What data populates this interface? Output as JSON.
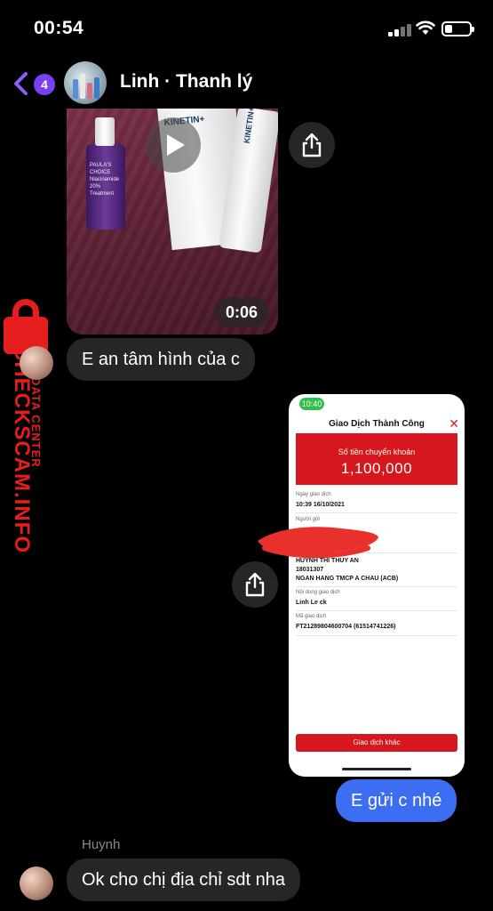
{
  "status_bar": {
    "time": "00:54",
    "signal_bars": 4,
    "battery_level_percent": 30
  },
  "header": {
    "back_count": "4",
    "title": "Linh · Thanh lý",
    "accent_color": "#7b3ff2"
  },
  "video_message": {
    "duration": "0:06",
    "product_brand_1": "PAULA'S CHOICE",
    "product_text_1": "Niacinamide 20% Treatment",
    "product_brand_2": "KINETIN+",
    "product_brand_3": "KINETIN+"
  },
  "messages": {
    "incoming_1": "E an tâm hình của c",
    "outgoing_1": "E gửi c nhé",
    "incoming_sender": "Huynh",
    "incoming_2": "Ok cho chị địa chỉ sdt nha"
  },
  "bank_screenshot": {
    "time": "10:40",
    "title": "Giao Dịch Thành Công",
    "amount_label": "Số tiền chuyển khoản",
    "amount": "1,100,000",
    "date_label": "Ngày giao dịch",
    "date_value": "10:39 16/10/2021",
    "sender_label": "Người gửi",
    "receiver_name": "HUYNH THI THUY AN",
    "receiver_account": "18031307",
    "receiver_bank": "NGAN HANG TMCP A CHAU (ACB)",
    "content_label": "Nội dung giao dịch",
    "content_value": "Linh Le ck",
    "code_label": "Mã giao dịch",
    "code_value": "FT21289804600704 (61514741226)",
    "button_label": "Giao dịch khác",
    "brand_color": "#d7171f"
  },
  "watermark": {
    "text": "CHECKSCAM.INFO",
    "subtext": "DATA CENTER",
    "color": "#e51d1d"
  },
  "colors": {
    "outgoing_bubble": "#3d6ef2",
    "incoming_bubble": "#262626"
  }
}
